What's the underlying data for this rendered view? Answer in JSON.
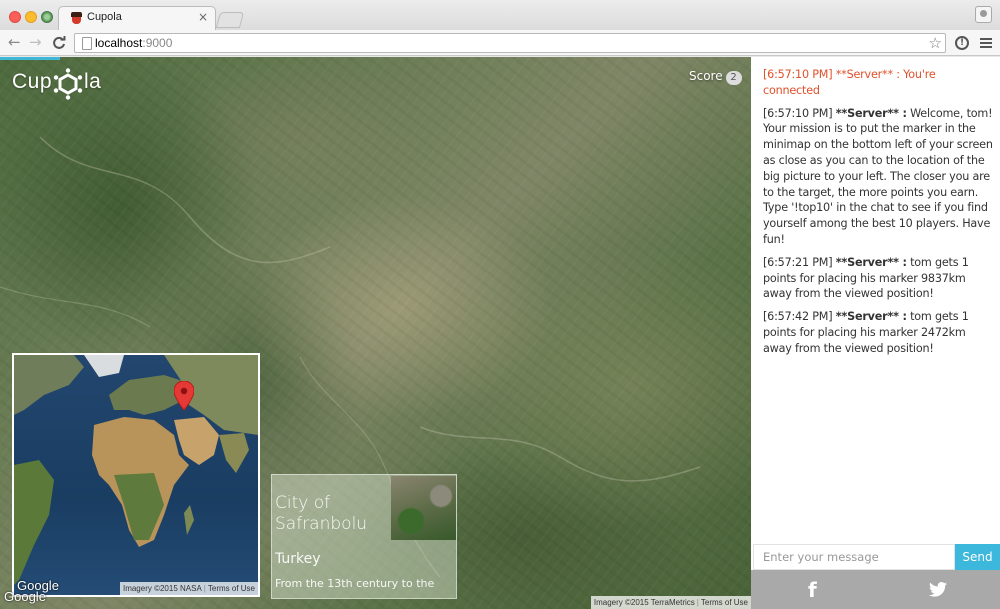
{
  "browser": {
    "tab_title": "Cupola",
    "tab_close": "×",
    "url_host": "localhost",
    "url_port": ":9000",
    "nav_back": "←",
    "nav_forward": "→",
    "nav_reload": "C",
    "star": "☆",
    "ext_icon": "!"
  },
  "app": {
    "logo_left": "Cup",
    "logo_right": "la",
    "score_label": "Score",
    "score_value": "2"
  },
  "minimap": {
    "google_label": "Google",
    "attribution": "Imagery ©2015 NASA",
    "terms": "Terms of Use"
  },
  "info_card": {
    "title": "City of Safranbolu",
    "country": "Turkey",
    "description": "From the 13th century to the"
  },
  "map": {
    "google_label": "Google",
    "attribution": "Imagery ©2015 TerraMetrics",
    "terms": "Terms of Use"
  },
  "chat": {
    "messages": [
      {
        "time": "[6:57:10 PM]",
        "sender": "**Server** :",
        "text": "You're connected",
        "type": "status"
      },
      {
        "time": "[6:57:10 PM]",
        "sender": "**Server** :",
        "text": "Welcome, tom! Your mission is to put the marker in the minimap on the bottom left of your screen as close as you can to the location of the big picture to your left. The closer you are to the target, the more points you earn. Type '!top10' in the chat to see if you find yourself among the best 10 players. Have fun!",
        "type": "server"
      },
      {
        "time": "[6:57:21 PM]",
        "sender": "**Server** :",
        "text": "tom gets 1 points for placing his marker 9837km away from the viewed position!",
        "type": "server"
      },
      {
        "time": "[6:57:42 PM]",
        "sender": "**Server** :",
        "text": "tom gets 1 points for placing his marker 2472km away from the viewed position!",
        "type": "server"
      }
    ],
    "input_placeholder": "Enter your message",
    "send_label": "Send"
  },
  "social": {
    "facebook_glyph": "f"
  },
  "colors": {
    "accent": "#3cb8dc",
    "status_text": "#e0502a",
    "social_bar": "#a9a9a9",
    "marker": "#e53935"
  }
}
